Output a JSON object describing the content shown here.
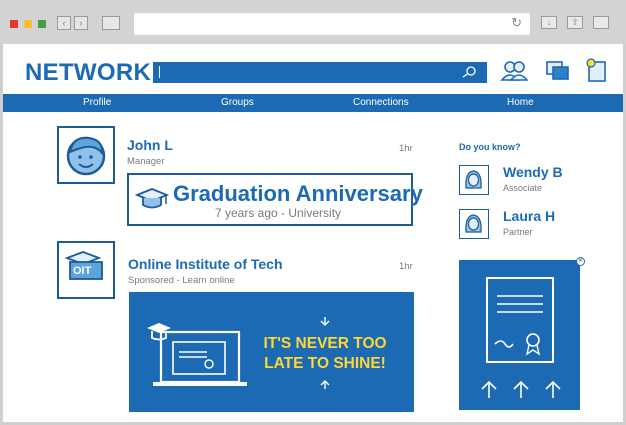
{
  "header": {
    "logo": "NETWORK"
  },
  "nav": {
    "items": [
      "Profile",
      "Groups",
      "Connections",
      "Home"
    ]
  },
  "feed": {
    "post1": {
      "name": "John L",
      "role": "Manager",
      "time": "1hr",
      "card_title": "Graduation Anniversary",
      "card_sub": "7 years ago - University"
    },
    "post2": {
      "logo_text": "OIT",
      "name": "Online Institute of Tech",
      "sub": "Sponsored - Learn online",
      "time": "1hr",
      "ad_line1": "IT'S NEVER TOO",
      "ad_line2": "LATE TO SHINE!"
    }
  },
  "sidebar": {
    "title": "Do you know?",
    "people": [
      {
        "name": "Wendy B",
        "role": "Associate"
      },
      {
        "name": "Laura H",
        "role": "Partner"
      }
    ]
  },
  "colors": {
    "brand": "#1d6ab4",
    "accent": "#fdd835"
  },
  "icons": [
    "search-icon",
    "connections-icon",
    "messages-icon",
    "notifications-icon",
    "graduation-cap-icon",
    "close-icon"
  ]
}
